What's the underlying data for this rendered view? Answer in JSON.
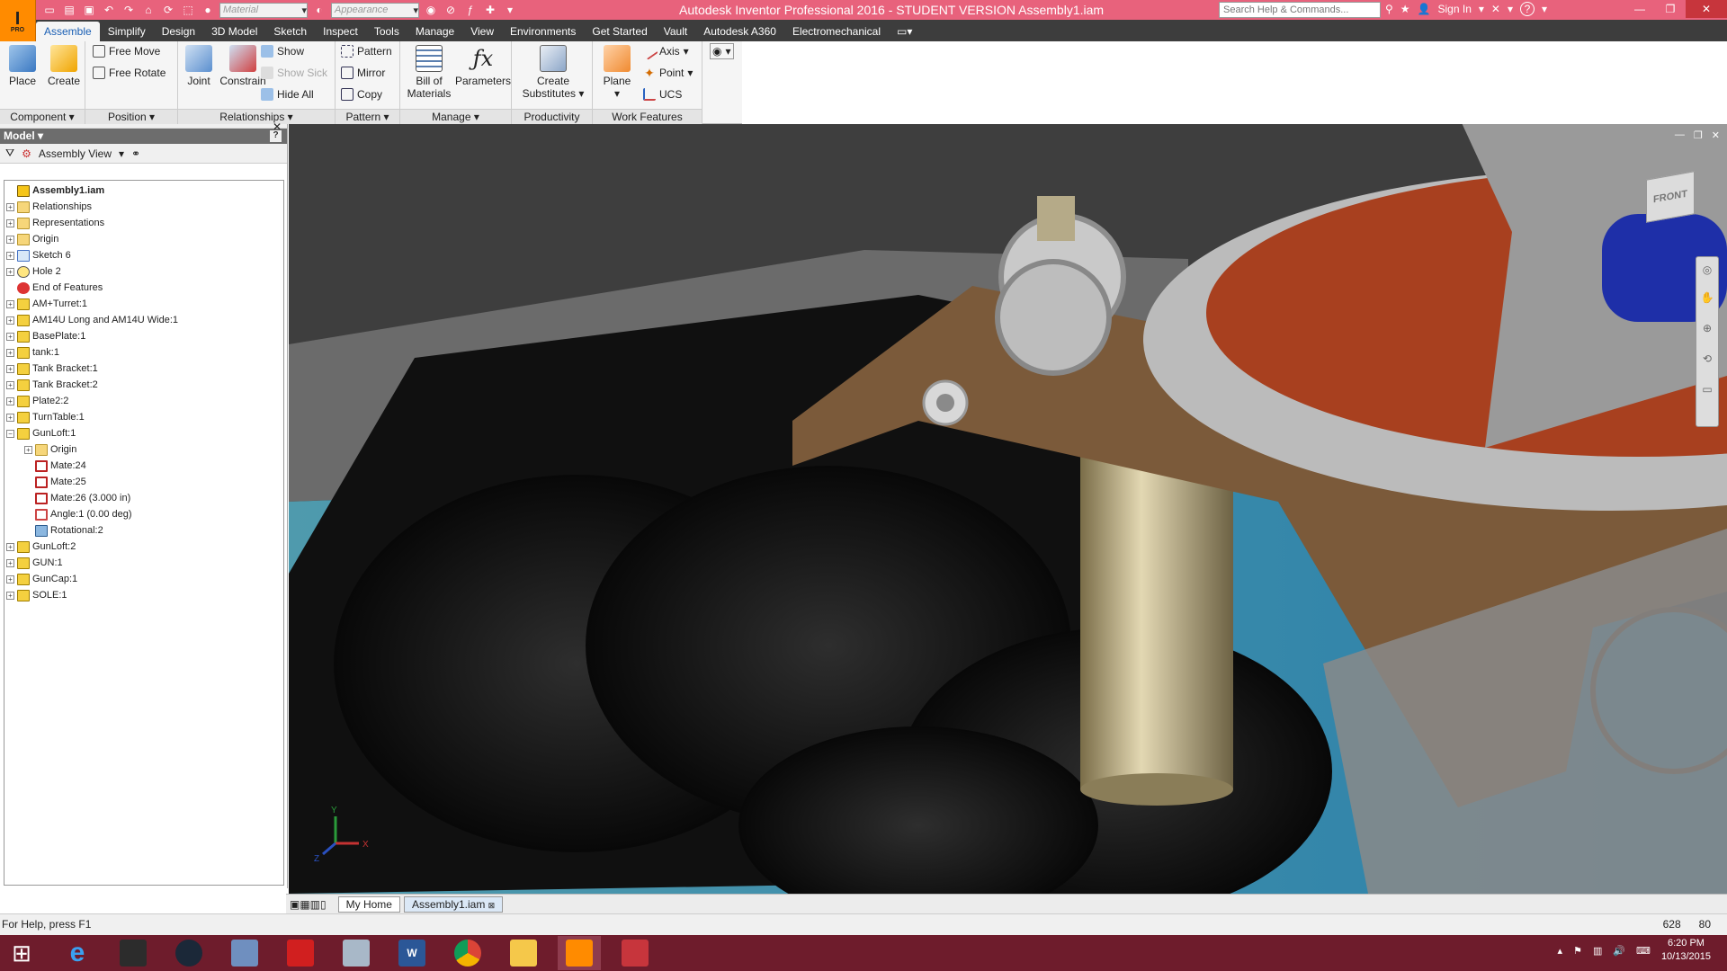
{
  "titlebar": {
    "title": "Autodesk Inventor Professional 2016 - STUDENT VERSION    Assembly1.iam",
    "app_icon_letter": "I",
    "app_icon_sub": "PRO",
    "material_placeholder": "Material",
    "appearance_placeholder": "Appearance",
    "search_placeholder": "Search Help & Commands...",
    "sign_in": "Sign In",
    "help": "?"
  },
  "tabs": [
    "Assemble",
    "Simplify",
    "Design",
    "3D Model",
    "Sketch",
    "Inspect",
    "Tools",
    "Manage",
    "View",
    "Environments",
    "Get Started",
    "Vault",
    "Autodesk A360",
    "Electromechanical"
  ],
  "ribbon": {
    "component": {
      "title": "Component",
      "place": "Place",
      "create": "Create"
    },
    "position": {
      "title": "Position",
      "free_move": "Free Move",
      "free_rotate": "Free Rotate"
    },
    "relationships": {
      "title": "Relationships",
      "joint": "Joint",
      "constrain": "Constrain",
      "show": "Show",
      "show_sick": "Show Sick",
      "hide_all": "Hide All"
    },
    "pattern": {
      "title": "Pattern",
      "pattern": "Pattern",
      "mirror": "Mirror",
      "copy": "Copy"
    },
    "manage": {
      "title": "Manage",
      "bom_line1": "Bill of",
      "bom_line2": "Materials",
      "parameters": "Parameters"
    },
    "productivity": {
      "title": "Productivity",
      "line1": "Create",
      "line2": "Substitutes"
    },
    "work_features": {
      "title": "Work Features",
      "plane": "Plane",
      "axis": "Axis",
      "point": "Point",
      "ucs": "UCS"
    }
  },
  "browser": {
    "title": "Model",
    "help": "?",
    "view_mode": "Assembly View",
    "tree": [
      {
        "label": "Assembly1.iam",
        "icon": "asm",
        "exp": "",
        "level": 0,
        "bold": true
      },
      {
        "label": "Relationships",
        "icon": "folder",
        "exp": "+",
        "level": 0
      },
      {
        "label": "Representations",
        "icon": "folder",
        "exp": "+",
        "level": 0
      },
      {
        "label": "Origin",
        "icon": "folder",
        "exp": "+",
        "level": 0
      },
      {
        "label": "Sketch 6",
        "icon": "sketch",
        "exp": "+",
        "level": 0
      },
      {
        "label": "Hole 2",
        "icon": "hole",
        "exp": "+",
        "level": 0
      },
      {
        "label": "End of Features",
        "icon": "end",
        "exp": "",
        "level": 0
      },
      {
        "label": "AM+Turret:1",
        "icon": "part",
        "exp": "+",
        "level": 0
      },
      {
        "label": "AM14U Long and AM14U Wide:1",
        "icon": "part",
        "exp": "+",
        "level": 0
      },
      {
        "label": "BasePlate:1",
        "icon": "part",
        "exp": "+",
        "level": 0
      },
      {
        "label": "tank:1",
        "icon": "part",
        "exp": "+",
        "level": 0
      },
      {
        "label": "Tank Bracket:1",
        "icon": "part",
        "exp": "+",
        "level": 0
      },
      {
        "label": "Tank Bracket:2",
        "icon": "part",
        "exp": "+",
        "level": 0
      },
      {
        "label": "Plate2:2",
        "icon": "part",
        "exp": "+",
        "level": 0
      },
      {
        "label": "TurnTable:1",
        "icon": "part",
        "exp": "+",
        "level": 0
      },
      {
        "label": "GunLoft:1",
        "icon": "part",
        "exp": "−",
        "level": 0
      },
      {
        "label": "Origin",
        "icon": "folder",
        "exp": "+",
        "level": 1
      },
      {
        "label": "Mate:24",
        "icon": "mate",
        "exp": "",
        "level": 1
      },
      {
        "label": "Mate:25",
        "icon": "mate",
        "exp": "",
        "level": 1
      },
      {
        "label": "Mate:26 (3.000 in)",
        "icon": "mate",
        "exp": "",
        "level": 1
      },
      {
        "label": "Angle:1 (0.00 deg)",
        "icon": "angle",
        "exp": "",
        "level": 1
      },
      {
        "label": "Rotational:2",
        "icon": "rot",
        "exp": "",
        "level": 1
      },
      {
        "label": "GunLoft:2",
        "icon": "part",
        "exp": "+",
        "level": 0
      },
      {
        "label": "GUN:1",
        "icon": "part",
        "exp": "+",
        "level": 0
      },
      {
        "label": "GunCap:1",
        "icon": "part",
        "exp": "+",
        "level": 0
      },
      {
        "label": "SOLE:1",
        "icon": "part",
        "exp": "+",
        "level": 0
      }
    ]
  },
  "viewport": {
    "viewcube_label": "FRONT",
    "triad": {
      "x": "X",
      "y": "Y",
      "z": "Z"
    }
  },
  "doc_tabs": {
    "home": "My Home",
    "assembly": "Assembly1.iam"
  },
  "status": {
    "help": "For Help, press F1",
    "num1": "628",
    "num2": "80"
  },
  "taskbar": {
    "time": "6:20 PM",
    "date": "10/13/2015"
  },
  "colors": {
    "accent_pink": "#e8627c",
    "app_orange": "#ff8b00",
    "taskbar": "#6e1c2c"
  }
}
